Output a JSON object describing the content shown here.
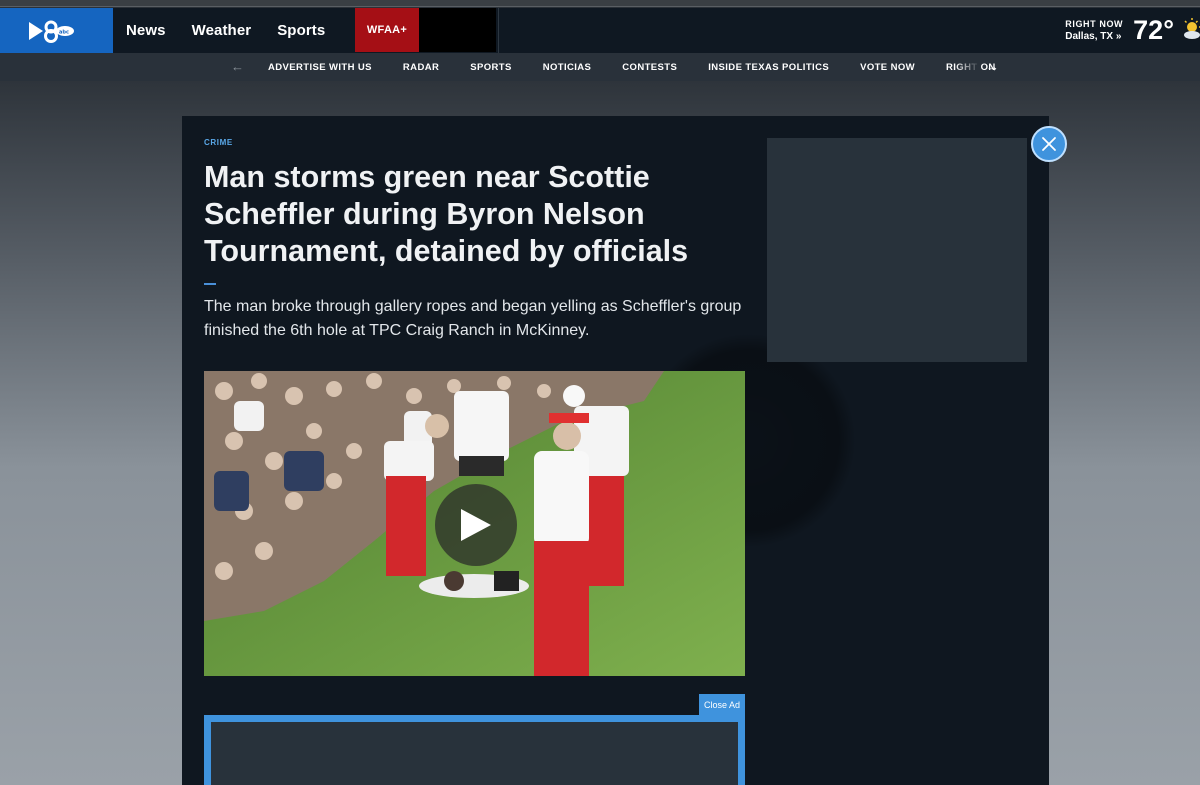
{
  "header": {
    "nav": [
      "News",
      "Weather",
      "Sports"
    ],
    "wfaa_plus_label": "WFAA+",
    "weather": {
      "label": "RIGHT NOW",
      "city": "Dallas, TX »",
      "temp": "72°"
    }
  },
  "subnav": {
    "items": [
      "ADVERTISE WITH US",
      "RADAR",
      "SPORTS",
      "NOTICIAS",
      "CONTESTS",
      "INSIDE TEXAS POLITICS",
      "VOTE NOW",
      "RIGHT ON"
    ]
  },
  "article": {
    "kicker": "CRIME",
    "headline": "Man storms green near Scottie Scheffler during Byron Nelson Tournament, detained by officials",
    "summary": "The man broke through gallery ropes and began yelling as Scheffler's group finished the 6th hole at TPC Craig Ranch in McKinney."
  },
  "ads": {
    "close_ad_label": "Close Ad"
  },
  "colors": {
    "brand_blue": "#1565c0",
    "accent_blue": "#3f93dd",
    "wfaa_red": "#a50f15",
    "header_bg": "#0f1822"
  },
  "icons": {
    "logo": "channel-8-logo-icon",
    "play": "play-icon",
    "close": "close-icon",
    "weather": "sun-cloud-icon"
  }
}
